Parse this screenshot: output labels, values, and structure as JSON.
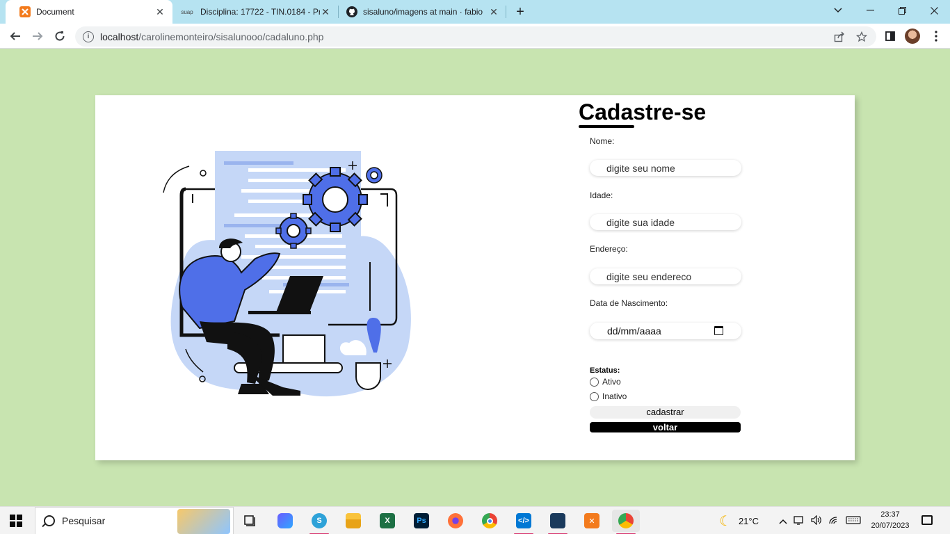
{
  "browser": {
    "tabs": [
      {
        "title": "Document",
        "favicon": "xampp-icon"
      },
      {
        "title": "Disciplina: 17722 - TIN.0184 - Pro",
        "favicon": "suap-icon",
        "favicon_text": "suap"
      },
      {
        "title": "sisaluno/imagens at main · fabio",
        "favicon": "github-icon"
      }
    ],
    "new_tab": "+",
    "url_host": "localhost",
    "url_path": "/carolinemonteiro/sisalunooo/cadaluno.php"
  },
  "page": {
    "title": "Cadastre-se",
    "fields": [
      {
        "label": "Nome:",
        "placeholder": "digite seu nome"
      },
      {
        "label": "Idade:",
        "placeholder": "digite sua idade"
      },
      {
        "label": "Endereço:",
        "placeholder": "digite seu endereco"
      },
      {
        "label": "Data de Nascimento:",
        "placeholder": "dd/mm/aaaa"
      }
    ],
    "status_label": "Estatus:",
    "status_options": [
      "Ativo",
      "Inativo"
    ],
    "submit_label": "cadastrar",
    "back_label": "voltar",
    "colors": {
      "page_bg": "#c8e4b0",
      "illustration_blue": "#4f6fe8",
      "illustration_light": "#c5d7f7"
    }
  },
  "taskbar": {
    "search_text": "Pesquisar",
    "weather": "21°C",
    "time": "23:37",
    "date": "20/07/2023"
  }
}
